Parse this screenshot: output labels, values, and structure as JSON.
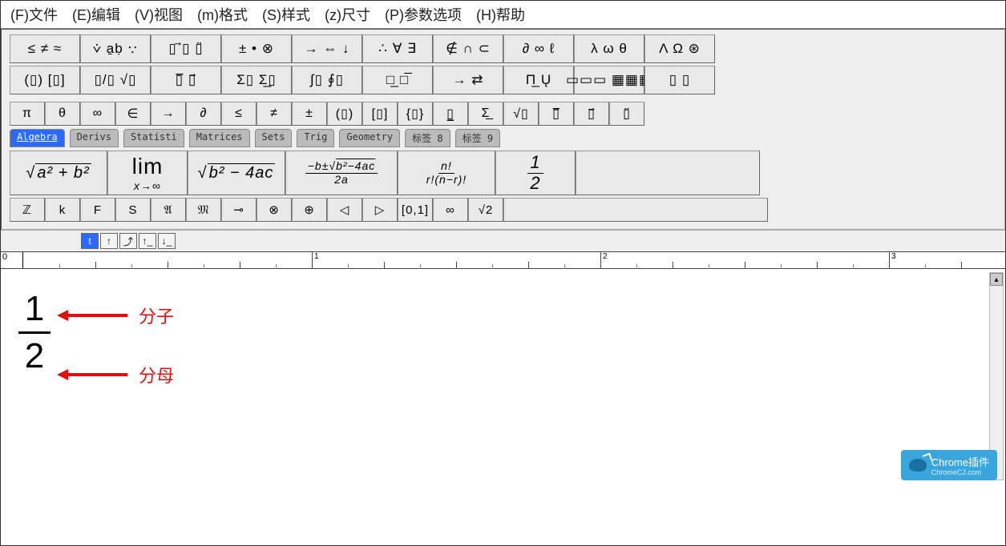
{
  "menu": {
    "file": "(F)文件",
    "edit": "(E)编辑",
    "view": "(V)视图",
    "format": "(m)格式",
    "style": "(S)样式",
    "size": "(z)尺寸",
    "params": "(P)参数选项",
    "help": "(H)帮助"
  },
  "palette": {
    "r1": [
      "≤ ≠ ≈",
      "⩒ a̱ḅ ∵",
      "▯ ⃗▯ ▯̈",
      "± • ⊗",
      "→ ⇔ ↓",
      "∴ ∀ ∃",
      "∉ ∩ ⊂",
      "∂ ∞ ℓ",
      "λ ω θ",
      "Λ Ω ⊛"
    ],
    "r2": [
      "(▯) [▯]",
      "▯/▯ √▯",
      "▯̅ ▯⃗",
      "Σ▯ Σ̲▯",
      "∫▯ ∮▯",
      "□̲ □̅",
      "→  ⇄",
      "Π̲  Ų",
      "▭▭▭ ▦▦▦",
      "▯  ▯"
    ],
    "r3": [
      "π",
      "θ",
      "∞",
      "∈",
      "→",
      "∂",
      "≤",
      "≠",
      "±",
      "(▯)",
      "[▯]",
      "{▯}",
      "▯̲",
      "Σ̲",
      "√▯",
      "▯̅",
      "▯⃗",
      "▯̈"
    ],
    "tabs": [
      "Algebra",
      "Derivs",
      "Statisti",
      "Matrices",
      "Sets",
      "Trig",
      "Geometry",
      "标签 8",
      "标签 9"
    ],
    "templates": {
      "t1": "√(a²+b²)",
      "t2_top": "lim",
      "t2_bot": "x→∞",
      "t3": "√(b²−4ac)",
      "t4_top": "−b±√(b²−4ac)",
      "t4_bot": "2a",
      "t5_top": "n!",
      "t5_bot": "r!(n−r)!",
      "t6_top": "1",
      "t6_bot": "2"
    },
    "r5": [
      "ℤ",
      "k",
      "F",
      "S",
      "𝔄",
      "𝔐",
      "⊸",
      "⊗",
      "⊕",
      "◁",
      "▷",
      "[0,1]",
      "∞",
      "√2"
    ]
  },
  "nav": {
    "b1": "t",
    "b2": "↑",
    "b3": "⤴",
    "b4": "↑_",
    "b5": "↓_"
  },
  "ruler": {
    "n0": "0",
    "n1": "1",
    "n2": "2",
    "n3": "3"
  },
  "doc": {
    "numerator": "1",
    "denominator": "2",
    "label_num": "分子",
    "label_den": "分母"
  },
  "watermark": {
    "title": "Chrome插件",
    "sub": "ChromeCJ.com"
  }
}
